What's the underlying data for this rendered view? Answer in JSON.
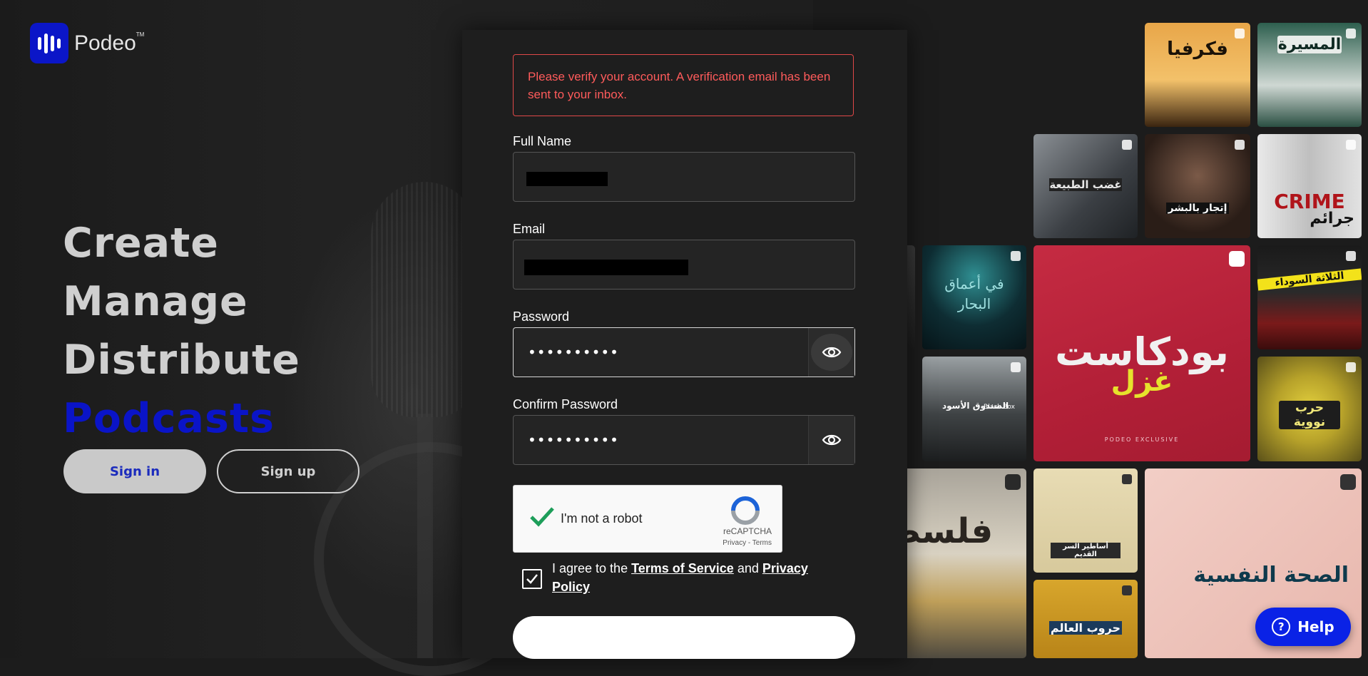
{
  "app": {
    "logo_text": "Podeo",
    "trademark": "TM"
  },
  "hero": {
    "lines": [
      "Create",
      "Manage",
      "Distribute"
    ],
    "accent": "Podcasts",
    "accent_color": "#0a14c8",
    "signin_label": "Sign in",
    "signup_label": "Sign up"
  },
  "form": {
    "alert": "Please verify your account. A verification email has been sent to your inbox.",
    "full_name_label": "Full Name",
    "email_label": "Email",
    "password_label": "Password",
    "password_value": "••••••••••",
    "confirm_label": "Confirm Password",
    "confirm_value": "••••••••••",
    "captcha": {
      "label": "I'm not a robot",
      "brand": "reCAPTCHA",
      "links": "Privacy - Terms"
    },
    "agree": {
      "prefix": "I agree to the ",
      "terms": "Terms of Service",
      "and": " and ",
      "privacy": "Privacy Policy"
    }
  },
  "collage": {
    "titles": [
      "فكرفيا",
      "المسيرة",
      "غضب الطبيعة",
      "إتجار بالبشر",
      "CRIME",
      "جرائم",
      "في أعماق البحار",
      "بودكاست",
      "غزل",
      "PODEO EXCLUSIVE",
      "الثلاثة السوداء",
      "الصندوق الأسود",
      "Black Box",
      "حرب نووية",
      "فلسطين",
      "أساطير السر القديم",
      "الصحة النفسية",
      "حروب العالم"
    ]
  },
  "help_label": "Help",
  "icons": {
    "eye": "eye-icon",
    "check": "check-icon",
    "help": "question-icon"
  }
}
